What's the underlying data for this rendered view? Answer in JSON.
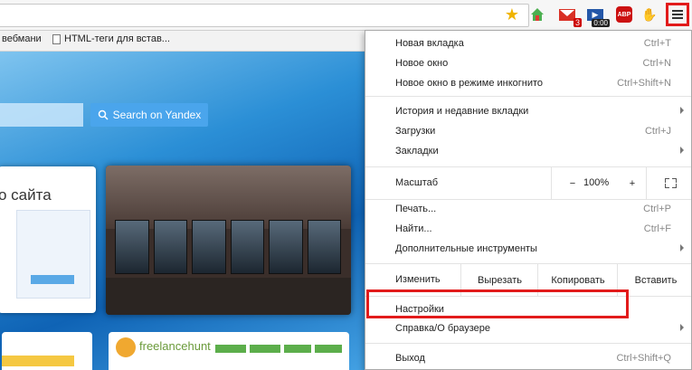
{
  "toolbar": {
    "extension_badges": {
      "mail_count": "3",
      "media_time": "0:00",
      "abp_label": "ABP"
    }
  },
  "bookmarks": [
    {
      "label": "вебмани"
    },
    {
      "label": "HTML-теги для встав..."
    }
  ],
  "page": {
    "search_button": "Search on Yandex",
    "tile1_title": "о сайта",
    "tile4_name": "freelancehunt"
  },
  "menu": {
    "group1": [
      {
        "label": "Новая вкладка",
        "shortcut": "Ctrl+T"
      },
      {
        "label": "Новое окно",
        "shortcut": "Ctrl+N"
      },
      {
        "label": "Новое окно в режиме инкогнито",
        "shortcut": "Ctrl+Shift+N"
      }
    ],
    "group2": [
      {
        "label": "История и недавние вкладки",
        "shortcut": ""
      },
      {
        "label": "Загрузки",
        "shortcut": "Ctrl+J"
      },
      {
        "label": "Закладки",
        "shortcut": ""
      }
    ],
    "zoom": {
      "label": "Масштаб",
      "minus": "−",
      "value": "100%",
      "plus": "+"
    },
    "group3": [
      {
        "label": "Печать...",
        "shortcut": "Ctrl+P"
      },
      {
        "label": "Найти...",
        "shortcut": "Ctrl+F"
      },
      {
        "label": "Дополнительные инструменты",
        "shortcut": ""
      }
    ],
    "edit": {
      "label": "Изменить",
      "cut": "Вырезать",
      "copy": "Копировать",
      "paste": "Вставить"
    },
    "settings": {
      "label": "Настройки"
    },
    "help": {
      "label": "Справка/О браузере"
    },
    "exit": {
      "label": "Выход",
      "shortcut": "Ctrl+Shift+Q"
    }
  },
  "colors": {
    "highlight": "#e21b1b"
  }
}
